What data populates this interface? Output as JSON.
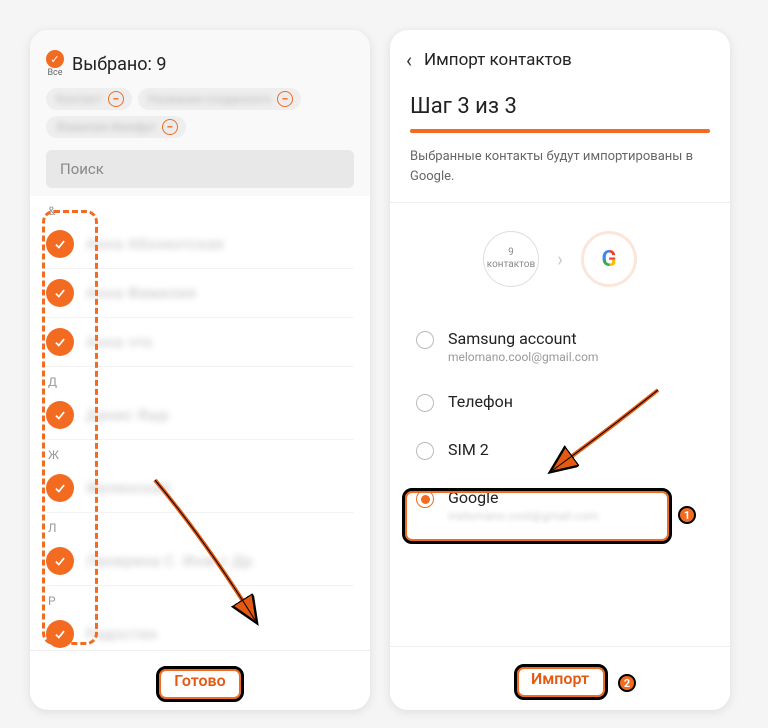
{
  "left": {
    "all_label": "Все",
    "selected_title": "Выбрано: 9",
    "chips": [
      "Контакт",
      "Название созданного",
      "Фамилия Имяфрт"
    ],
    "search_placeholder": "Поиск",
    "sections": [
      {
        "letter": "&",
        "items": [
          "Анна Абонентская",
          "Анна Фамилия",
          "Анна что"
        ]
      },
      {
        "letter": "Д",
        "items": [
          "Данис Яшр"
        ]
      },
      {
        "letter": "Ж",
        "items": [
          "Желенский"
        ]
      },
      {
        "letter": "Л",
        "items": [
          "Ланирина С. Инж с Др"
        ]
      },
      {
        "letter": "Р",
        "items": [
          "Радостин"
        ]
      }
    ],
    "done_label": "Готово"
  },
  "right": {
    "header_title": "Импорт контактов",
    "step_title": "Шаг 3 из 3",
    "step_desc": "Выбранные контакты будут импортированы в Google.",
    "contacts_count": "9 контактов",
    "accounts": [
      {
        "label": "Samsung account",
        "sub": "melomano.cool@gmail.com",
        "selected": false
      },
      {
        "label": "Телефон",
        "sub": "",
        "selected": false
      },
      {
        "label": "SIM 2",
        "sub": "",
        "selected": false
      },
      {
        "label": "Google",
        "sub": "melomano.cool@gmail.com",
        "selected": true
      }
    ],
    "import_label": "Импорт"
  },
  "annotations": {
    "badge1": "1",
    "badge2": "2"
  }
}
